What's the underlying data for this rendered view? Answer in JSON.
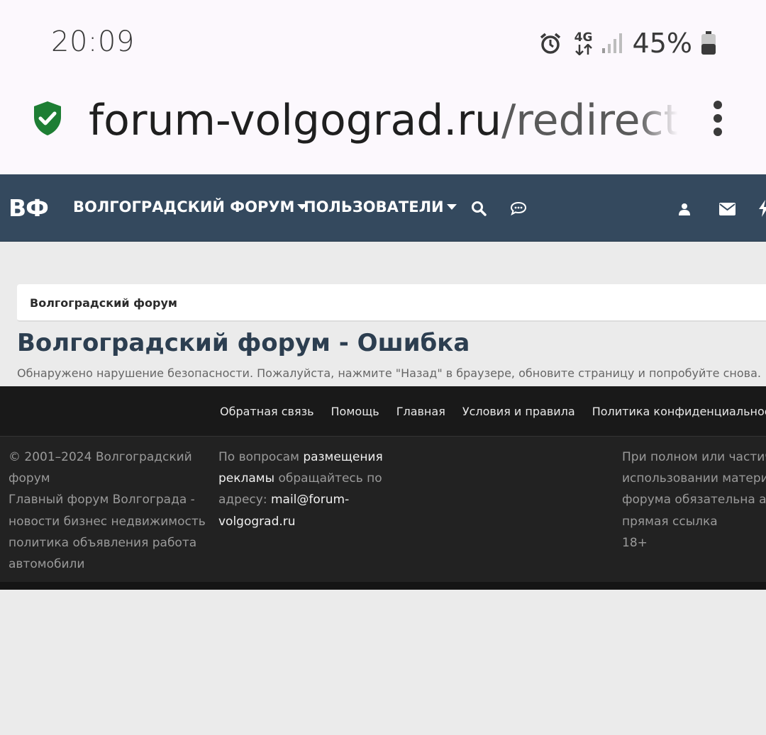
{
  "status_bar": {
    "time": "20:09",
    "network": "4G",
    "battery_percent": "45%",
    "icons": [
      "alarm-icon",
      "data-arrows-icon",
      "signal-icon",
      "battery-icon"
    ]
  },
  "url_bar": {
    "host": "forum-volgograd.ru",
    "path": "/redirect/?",
    "secure_icon": "shield-check-icon",
    "menu_icon": "kebab-menu-icon"
  },
  "nav": {
    "logo": "ВФ",
    "items": [
      {
        "label": "ВОЛГОГРАДСКИЙ ФОРУМ"
      },
      {
        "label": "ПОЛЬЗОВАТЕЛИ"
      }
    ],
    "icons": [
      "search-icon",
      "chat-icon",
      "user-icon",
      "mail-icon",
      "bolt-icon"
    ]
  },
  "breadcrumb": "Волгоградский форум",
  "page": {
    "title": "Волгоградский форум - Ошибка",
    "message": "Обнаружено нарушение безопасности. Пожалуйста, нажмите \"Назад\" в браузере, обновите страницу и попробуйте снова."
  },
  "footer": {
    "links": [
      "Обратная связь",
      "Помощь",
      "Главная",
      "Условия и правила",
      "Политика конфиденциальности"
    ],
    "col1": {
      "copyright_line1": "© 2001–2024 Волгоградский",
      "copyright_line2": "форум",
      "desc_line1": "Главный форум Волгограда -",
      "desc_line2": "новости бизнес недвижимость",
      "desc_line3": "политика объявления работа",
      "desc_line4": "автомобили"
    },
    "col2": {
      "part1": "По вопросам ",
      "link1a": "размещения",
      "link1b": "рекламы",
      "part2": " обращайтесь по",
      "part3": "адресу: ",
      "email_a": "mail@forum-",
      "email_b": "volgograd.ru"
    },
    "col3": {
      "line1": "При полном или частич",
      "line2": "использовании матери",
      "line3": "форума обязательна ак",
      "line4": "прямая ссылка",
      "line5": "18+"
    }
  },
  "colors": {
    "nav_bg": "#34495e",
    "title": "#2c3e50",
    "shield": "#1e7e34",
    "footer_bg": "#222222"
  }
}
